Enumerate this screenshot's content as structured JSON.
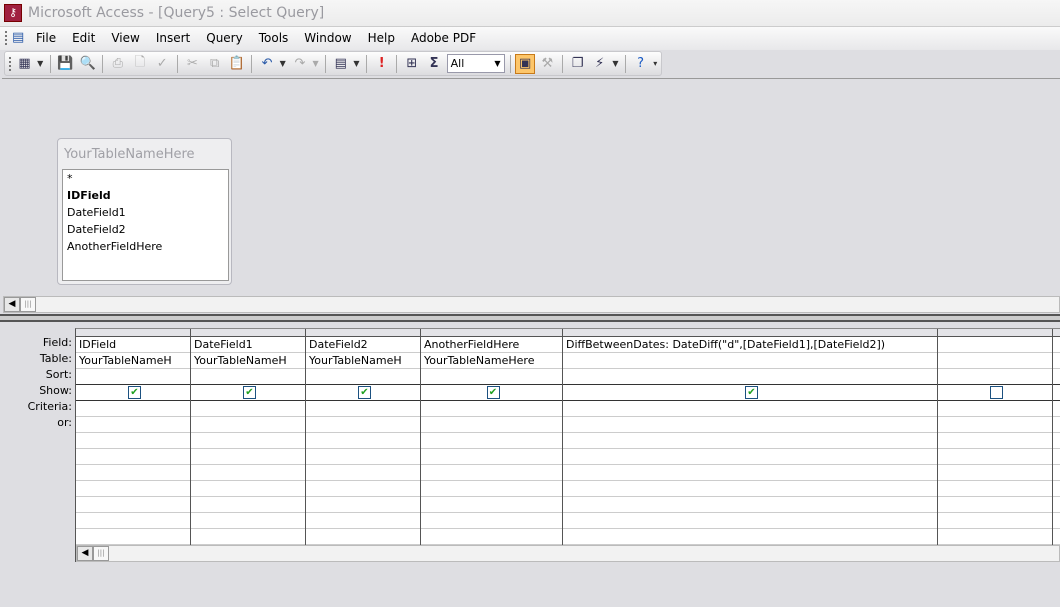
{
  "window": {
    "title": "Microsoft Access - [Query5 : Select Query]"
  },
  "menu": [
    "File",
    "Edit",
    "View",
    "Insert",
    "Query",
    "Tools",
    "Window",
    "Help",
    "Adobe PDF"
  ],
  "toolbar": {
    "top_values": "All"
  },
  "table_box": {
    "title": "YourTableNameHere",
    "fields": [
      "*",
      "IDField",
      "DateField1",
      "DateField2",
      "AnotherFieldHere"
    ]
  },
  "grid": {
    "row_labels": [
      "Field:",
      "Table:",
      "Sort:",
      "Show:",
      "Criteria:",
      "or:"
    ],
    "columns": [
      {
        "field": "IDField",
        "table": "YourTableNameH",
        "sort": "",
        "show": true
      },
      {
        "field": "DateField1",
        "table": "YourTableNameH",
        "sort": "",
        "show": true
      },
      {
        "field": "DateField2",
        "table": "YourTableNameH",
        "sort": "",
        "show": true
      },
      {
        "field": "AnotherFieldHere",
        "table": "YourTableNameHere",
        "sort": "",
        "show": true
      },
      {
        "field": "DiffBetweenDates: DateDiff(\"d\",[DateField1],[DateField2])",
        "table": "",
        "sort": "",
        "show": true
      },
      {
        "field": "",
        "table": "",
        "sort": "",
        "show": false
      },
      {
        "field": "",
        "table": "",
        "sort": "",
        "show": false
      }
    ]
  }
}
